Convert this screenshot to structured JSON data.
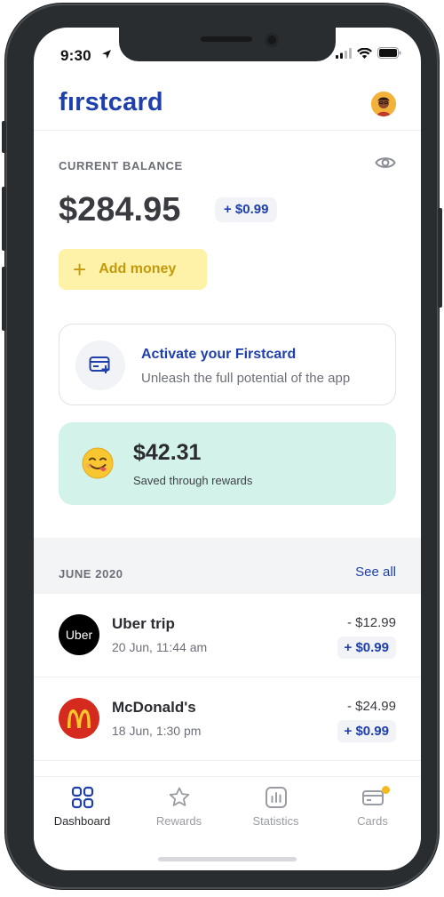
{
  "status_bar": {
    "time": "9:30"
  },
  "header": {
    "logo_text": "fırstcard",
    "avatar": "user-avatar"
  },
  "balance": {
    "label": "CURRENT BALANCE",
    "amount": "$284.95",
    "change": "+ $0.99",
    "add_money_label": "Add money",
    "add_money_icon": "plus-icon"
  },
  "activate": {
    "title": "Activate your Firstcard",
    "subtitle": "Unleash the full potential of the app",
    "icon": "card-add-icon"
  },
  "rewards": {
    "amount": "$42.31",
    "subtitle": "Saved through rewards",
    "icon": "savoring-face-emoji"
  },
  "transactions": {
    "section_title": "JUNE 2020",
    "see_all_label": "See all",
    "items": [
      {
        "merchant": "Uber trip",
        "date": "20 Jun, 11:44 am",
        "amount": "- $12.99",
        "reward": "+ $0.99",
        "logo_text": "Uber",
        "logo_color": "#000000"
      },
      {
        "merchant": "McDonald's",
        "date": "18 Jun, 1:30 pm",
        "amount": "- $24.99",
        "reward": "+ $0.99",
        "logo_text": "M",
        "logo_color": "#d52b1e"
      }
    ]
  },
  "tabbar": {
    "tabs": [
      {
        "label": "Dashboard",
        "icon": "grid-icon",
        "active": true
      },
      {
        "label": "Rewards",
        "icon": "star-icon",
        "active": false
      },
      {
        "label": "Statistics",
        "icon": "bar-chart-icon",
        "active": false
      },
      {
        "label": "Cards",
        "icon": "card-icon",
        "active": false,
        "badge_color": "#f5b921"
      }
    ]
  },
  "colors": {
    "brand": "#1f3fad",
    "add_money_bg": "#fdf2a7",
    "add_money_text": "#c49a0c",
    "rewards_bg": "#d2f2ea"
  }
}
